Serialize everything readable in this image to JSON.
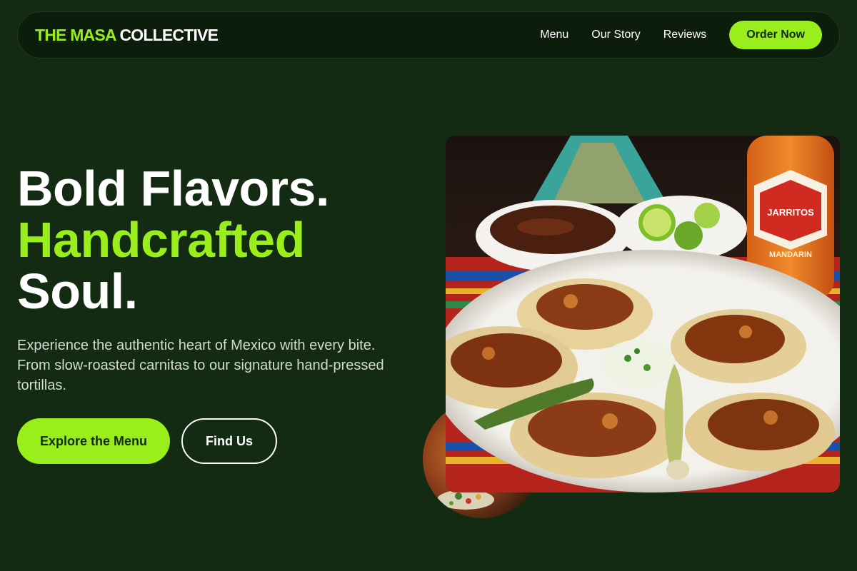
{
  "brand": {
    "accent_part": "THE MASA",
    "rest_part": "COLLECTIVE"
  },
  "nav": {
    "links": [
      "Menu",
      "Our Story",
      "Reviews"
    ],
    "cta_label": "Order Now"
  },
  "hero": {
    "title_line1": "Bold Flavors.",
    "title_line2": "Handcrafted",
    "title_line3": "Soul.",
    "description": "Experience the authentic heart of Mexico with every bite. From slow-roasted carnitas to our signature hand-pressed tortillas.",
    "primary_button": "Explore the Menu",
    "secondary_button": "Find Us"
  },
  "photo": {
    "bottle_brand": "JARRITOS",
    "bottle_flavor": "MANDARIN"
  },
  "colors": {
    "background": "#132a13",
    "nav_background": "#0c1d0b",
    "accent": "#9aee1c",
    "text": "#ffffff"
  },
  "icons": [
    "tacos-photo",
    "food-circle-photo"
  ]
}
